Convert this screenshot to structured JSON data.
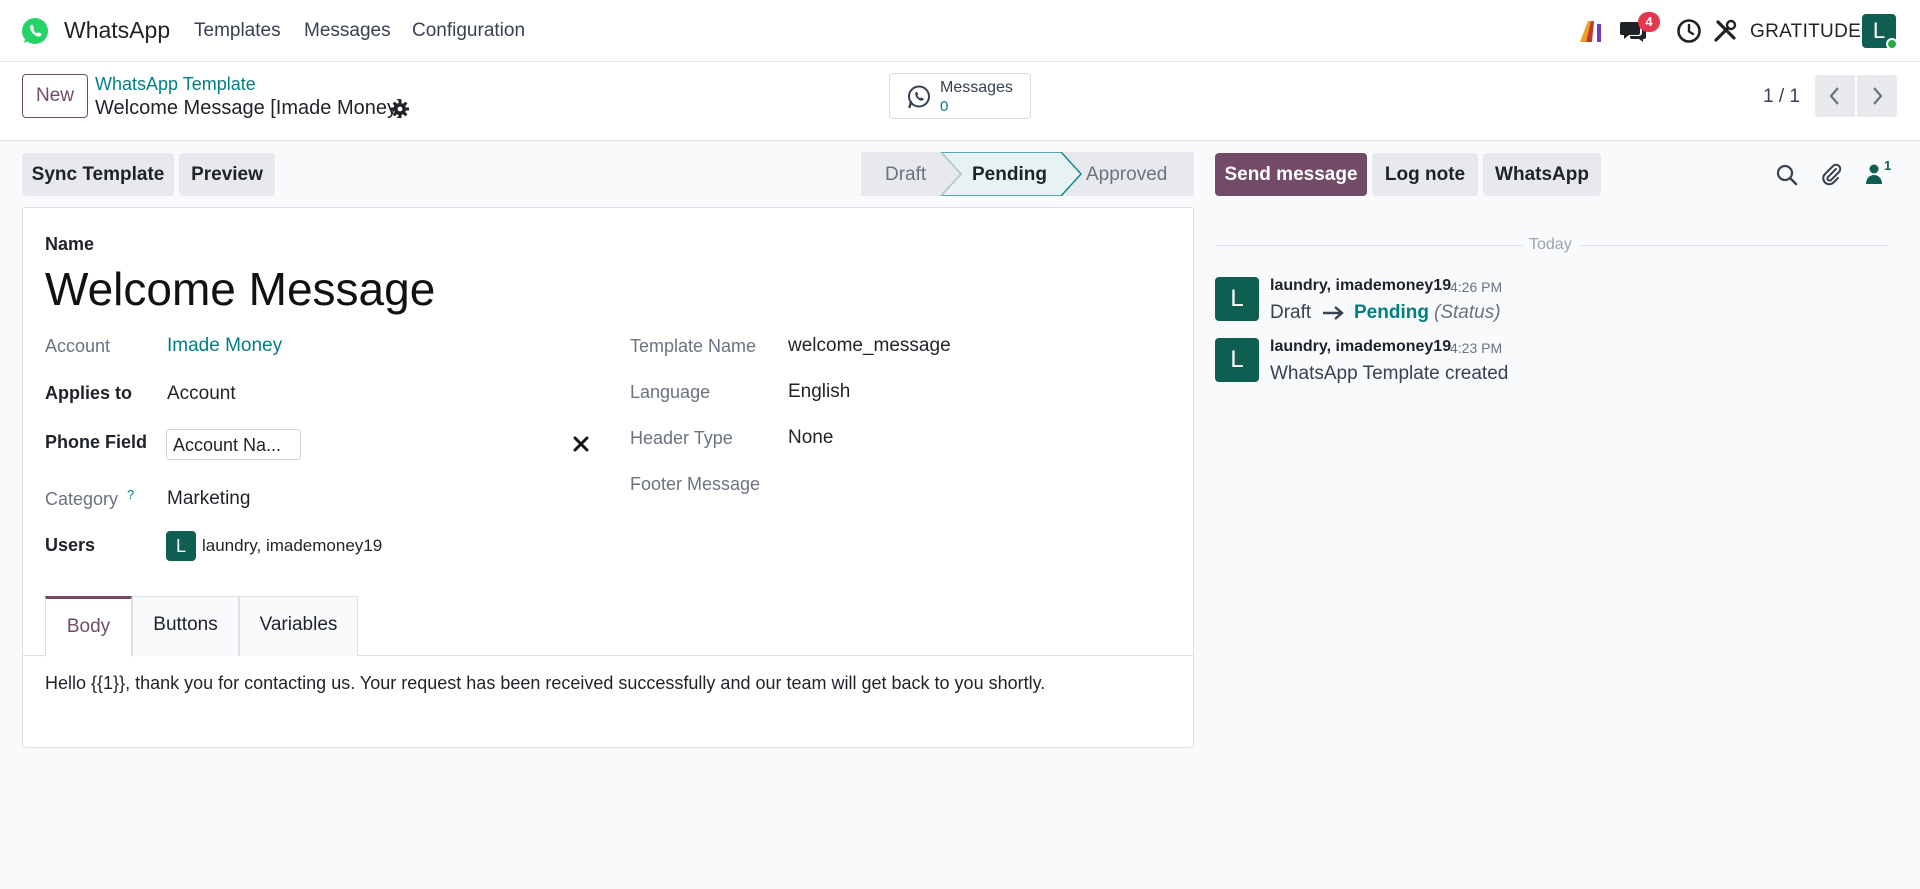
{
  "navbar": {
    "app_name": "WhatsApp",
    "menu": [
      "Templates",
      "Messages",
      "Configuration"
    ],
    "chat_badge": "4",
    "company": "GRATITUDE",
    "avatar_initial": "L"
  },
  "control_panel": {
    "new_label": "New",
    "breadcrumb_parent": "WhatsApp Template",
    "breadcrumb_current": "Welcome Message [Imade Money]",
    "smart_button": {
      "label": "Messages",
      "value": "0"
    },
    "pager": "1 / 1"
  },
  "actions": {
    "sync": "Sync Template",
    "preview": "Preview"
  },
  "status": {
    "steps": [
      "Draft",
      "Pending",
      "Approved"
    ],
    "current": "Pending"
  },
  "form": {
    "name_label": "Name",
    "name_value": "Welcome Message",
    "left": [
      {
        "label": "Account",
        "value": "Imade Money"
      },
      {
        "label": "Applies to",
        "value": "Account"
      },
      {
        "label": "Phone Field",
        "value": "Account Na..."
      },
      {
        "label": "Category",
        "help": "?",
        "value": "Marketing"
      },
      {
        "label": "Users",
        "value": "laundry, imademoney19",
        "avatar": "L"
      }
    ],
    "right": [
      {
        "label": "Template Name",
        "value": "welcome_message"
      },
      {
        "label": "Language",
        "value": "English"
      },
      {
        "label": "Header Type",
        "value": "None"
      },
      {
        "label": "Footer Message",
        "value": ""
      }
    ],
    "tabs": [
      "Body",
      "Buttons",
      "Variables"
    ],
    "active_tab": "Body",
    "body_text": "Hello {{1}}, thank you for contacting us. Your request has been received successfully and our team will get back to you shortly."
  },
  "chatter": {
    "send_message": "Send message",
    "log_note": "Log note",
    "whatsapp": "WhatsApp",
    "followers_count": "1",
    "date_separator": "Today",
    "messages": [
      {
        "avatar": "L",
        "author": "laundry, imademoney19",
        "time": "4:26 PM",
        "tracking": {
          "old": "Draft",
          "new": "Pending",
          "field": "(Status)"
        }
      },
      {
        "avatar": "L",
        "author": "laundry, imademoney19",
        "time": "4:23 PM",
        "text": "WhatsApp Template created"
      }
    ]
  },
  "colors": {
    "brand": "#714b67",
    "link": "#017e84",
    "avatar": "#0f5e52",
    "badge": "#e1384d",
    "whatsapp_green": "#25d366"
  }
}
